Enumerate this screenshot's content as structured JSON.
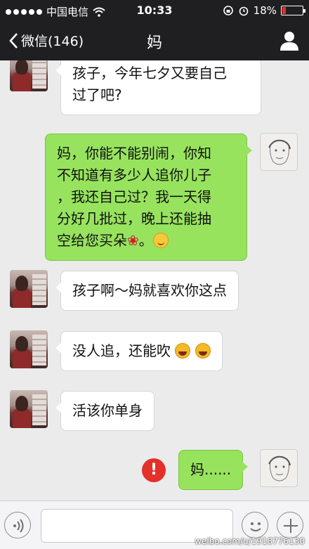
{
  "status_bar": {
    "carrier": "中国电信",
    "time": "10:33",
    "battery_percent": "18%",
    "battery_level": 0.18,
    "signal_dots_filled": 5
  },
  "nav": {
    "back_label": "微信(146)",
    "title": "妈",
    "profile_icon": "person-icon"
  },
  "messages": [
    {
      "from": "mom",
      "lines": [
        "孩子，今年七夕又要自己",
        "过了吧?"
      ]
    },
    {
      "from": "me",
      "lines": [
        "妈，你能不能别闹，你知",
        "不知道有多少人追你儿子",
        "，我还自己过？我一天得",
        "分好几批过，晚上还能抽",
        "空给您买朵"
      ],
      "tail": "。"
    },
    {
      "from": "mom",
      "text": "孩子啊～妈就喜欢你这点"
    },
    {
      "from": "mom",
      "text": "没人追，还能吹"
    },
    {
      "from": "mom",
      "text": "活该你单身"
    },
    {
      "from": "me",
      "text": "妈......",
      "failed": true
    }
  ],
  "error_icon_text": "!",
  "watermark": "weibo.com/u/1918776130",
  "colors": {
    "bar_bg": "#1f1f22",
    "chat_bg": "#ebebeb",
    "bubble_me": "#97e35e",
    "bubble_them": "#ffffff",
    "error": "#e3312a"
  }
}
